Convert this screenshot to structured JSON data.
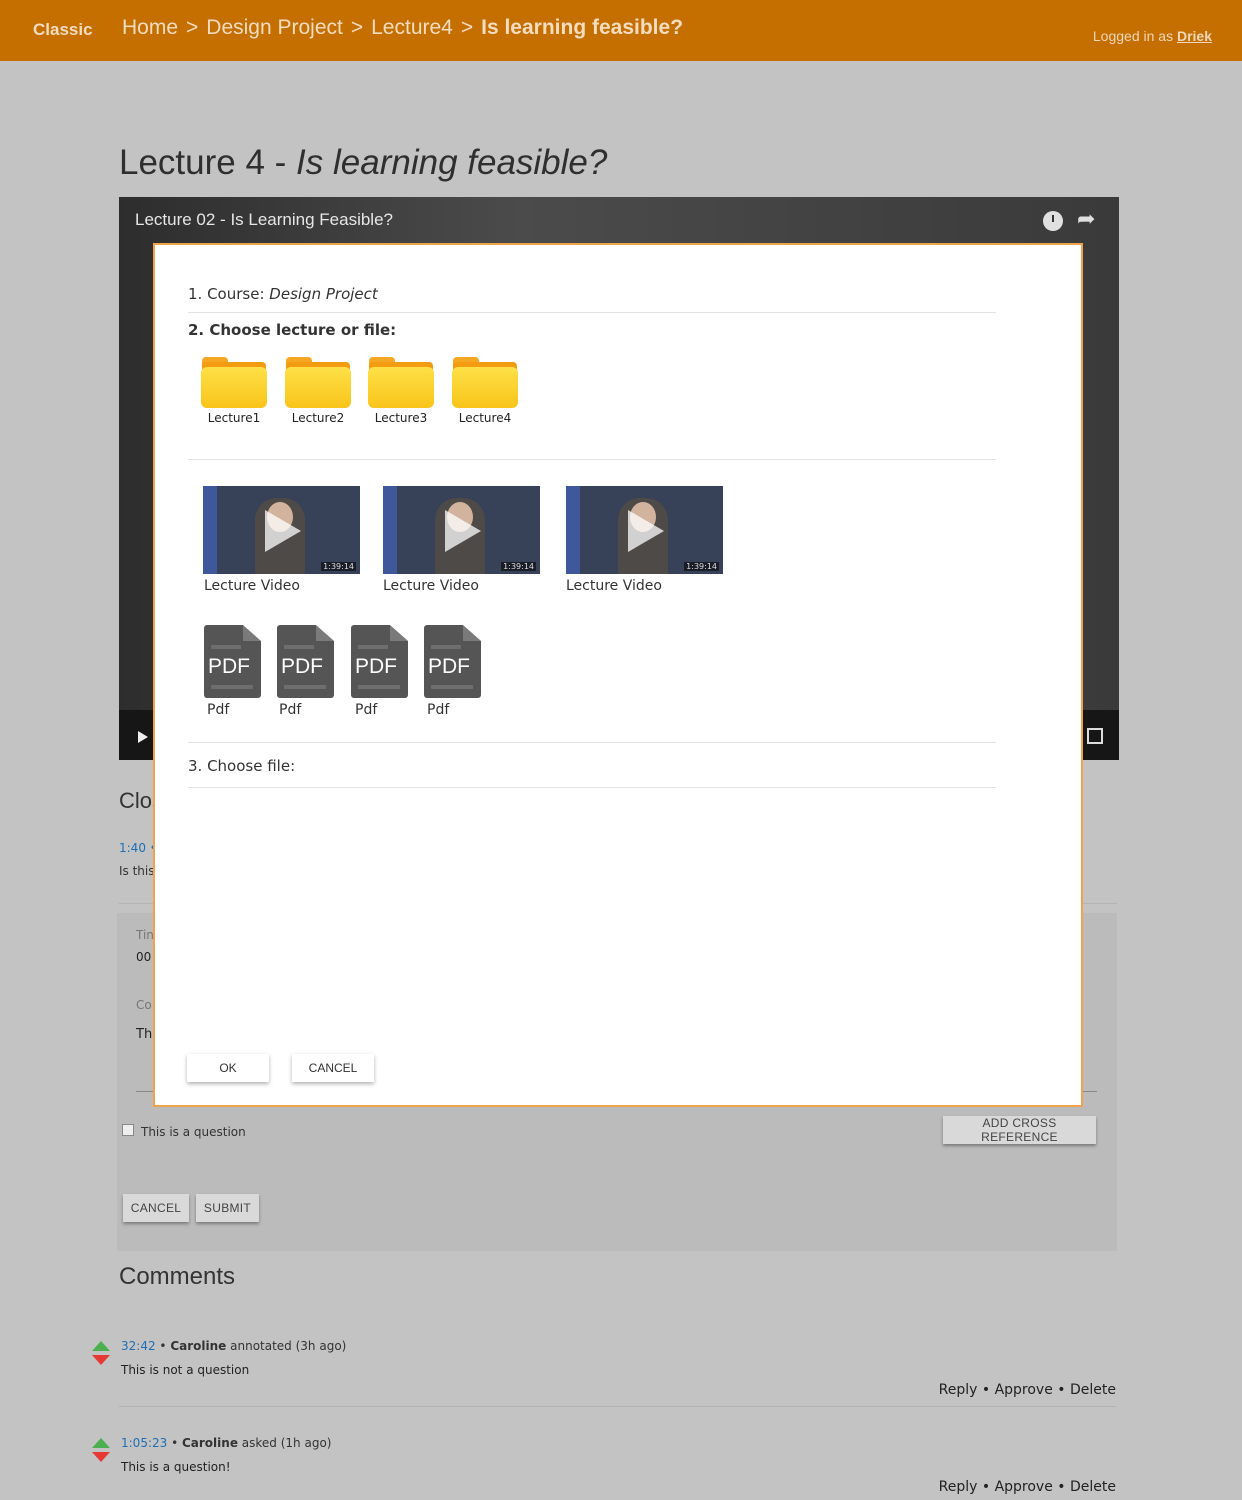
{
  "header": {
    "brand": "Classic",
    "breadcrumbs": [
      "Home",
      "Design Project",
      "Lecture4",
      "Is learning feasible?"
    ],
    "separator": ">",
    "logged_in_prefix": "Logged in as",
    "user": "Driek"
  },
  "lecture": {
    "prefix": "Lecture 4 - ",
    "title": "Is learning feasible?"
  },
  "video": {
    "title": "Lecture 02 - Is Learning Feasible?"
  },
  "behind": {
    "closed_heading_fragment": "Clos",
    "timestamp": "1:40 •",
    "text_fragment": "Is this",
    "form": {
      "time_label_fragment": "Tin",
      "time_value_fragment": "00",
      "comment_label_fragment": "Co",
      "comment_value_fragment": "Th",
      "question_checkbox_label": "This is a question",
      "add_cross_reference": "ADD CROSS REFERENCE",
      "cancel": "CANCEL",
      "submit": "SUBMIT"
    }
  },
  "comments": {
    "heading": "Comments",
    "items": [
      {
        "timestamp": "32:42",
        "author": "Caroline",
        "action": "annotated (3h ago)",
        "body": "This is not a question",
        "actions": "Reply • Approve • Delete"
      },
      {
        "timestamp": "1:05:23",
        "author": "Caroline",
        "action": "asked (1h ago)",
        "body": "This is a question!",
        "actions": "Reply • Approve • Delete"
      }
    ]
  },
  "modal": {
    "course_label": "1. Course:",
    "course_value": "Design Project",
    "choose_label": "2. Choose lecture or file:",
    "folders": [
      "Lecture1",
      "Lecture2",
      "Lecture3",
      "Lecture4"
    ],
    "videos": [
      {
        "label": "Lecture Video",
        "duration": "1:39:14"
      },
      {
        "label": "Lecture Video",
        "duration": "1:39:14"
      },
      {
        "label": "Lecture Video",
        "duration": "1:39:14"
      }
    ],
    "pdfs": [
      {
        "label": "Pdf",
        "icon_text": "PDF"
      },
      {
        "label": "Pdf",
        "icon_text": "PDF"
      },
      {
        "label": "Pdf",
        "icon_text": "PDF"
      },
      {
        "label": "Pdf",
        "icon_text": "PDF"
      }
    ],
    "choose_file_label": "3. Choose file:",
    "ok": "OK",
    "cancel": "CANCEL"
  },
  "colors": {
    "header_bg": "#c46f00",
    "modal_border": "#f0a34a",
    "link": "#1f6fb5",
    "upvote": "#4caf50",
    "downvote": "#e53935"
  }
}
